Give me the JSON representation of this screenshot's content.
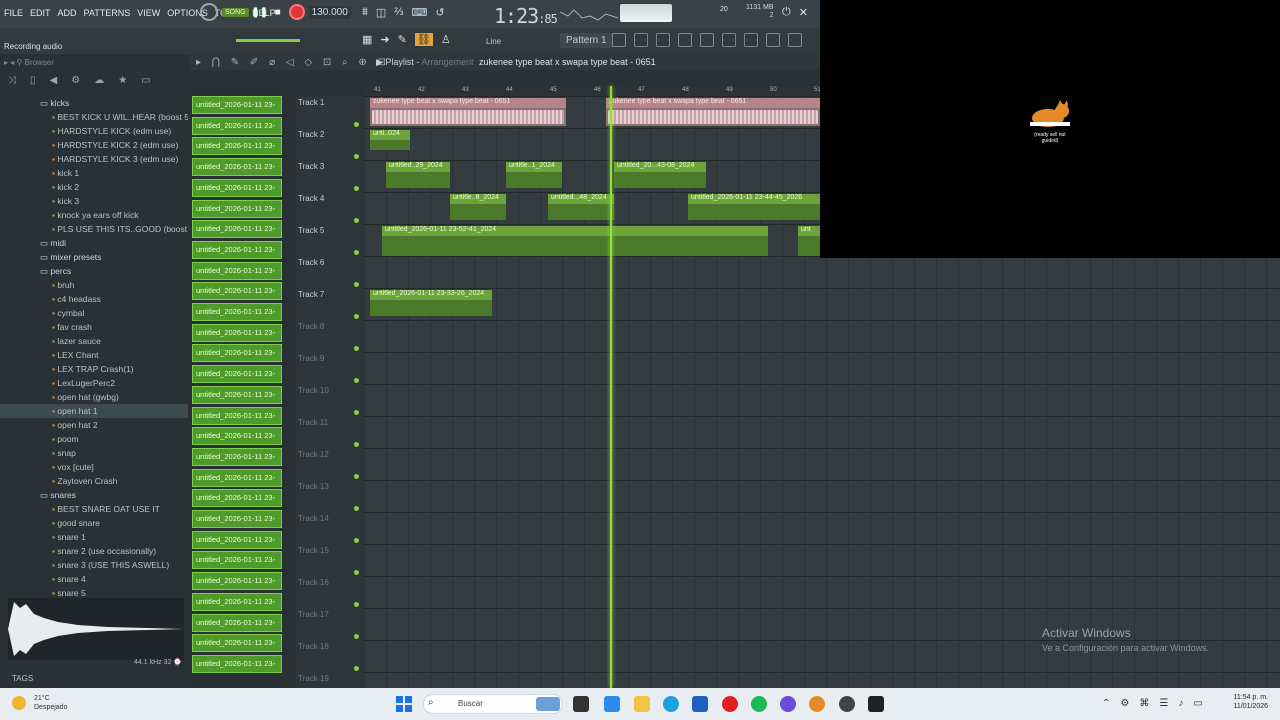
{
  "menu": [
    "FILE",
    "EDIT",
    "ADD",
    "PATTERNS",
    "VIEW",
    "OPTIONS",
    "TOOLS",
    "HELP"
  ],
  "transport": {
    "song_mode": "SONG",
    "tempo": "130.000",
    "time": "1:23",
    "time_small": ":85",
    "cpu_line1": "1131 MB",
    "cpu_line2": "2",
    "cpu_line3": "20"
  },
  "recording_label": "Recording audio",
  "toolbar": {
    "snap": "Line",
    "pattern": "Pattern 1"
  },
  "browser": {
    "title": "Browser",
    "tags": "TAGS",
    "wave_info": "44.1 kHz 32 ⌚",
    "items": [
      {
        "label": "kicks",
        "folder": true
      },
      {
        "label": "BEST KICK U WIL..HEAR (boost 5%)"
      },
      {
        "label": "HARDSTYLE KICK (edm use)"
      },
      {
        "label": "HARDSTYLE KICK 2 (edm use)"
      },
      {
        "label": "HARDSTYLE KICK 3 (edm use)"
      },
      {
        "label": "kick 1"
      },
      {
        "label": "kick 2"
      },
      {
        "label": "kick 3"
      },
      {
        "label": "knock ya ears off kick"
      },
      {
        "label": "PLS USE THIS ITS..GOOD (boost 8%)"
      },
      {
        "label": "midi",
        "folder": true
      },
      {
        "label": "mixer presets",
        "folder": true
      },
      {
        "label": "percs",
        "folder": true
      },
      {
        "label": "bruh"
      },
      {
        "label": "c4 headass"
      },
      {
        "label": "cymbal"
      },
      {
        "label": "fav crash"
      },
      {
        "label": "lazer sauce"
      },
      {
        "label": "LEX Chant"
      },
      {
        "label": "LEX TRAP Crash(1)"
      },
      {
        "label": "LexLugerPerc2"
      },
      {
        "label": "open hat (gwbg)"
      },
      {
        "label": "open hat 1",
        "selected": true
      },
      {
        "label": "open hat 2"
      },
      {
        "label": "poom"
      },
      {
        "label": "snap"
      },
      {
        "label": "vox [cute]"
      },
      {
        "label": "Zaytoven Crash"
      },
      {
        "label": "snares",
        "folder": true
      },
      {
        "label": "BEST SNARE OAT USE IT"
      },
      {
        "label": "good snare"
      },
      {
        "label": "snare 1"
      },
      {
        "label": "snare 2 (use occasionally)"
      },
      {
        "label": "snare 3 (USE THIS ASWELL)"
      },
      {
        "label": "snare 4"
      },
      {
        "label": "snare 5"
      }
    ]
  },
  "patterns": "untitled_2026-01-11 23-",
  "playlist": {
    "title": "Playlist",
    "sub": "Arrangement",
    "project": "zukenee type beat x swapa type beat - 0651",
    "tracks": [
      "Track 1",
      "Track 2",
      "Track 3",
      "Track 4",
      "Track 5",
      "Track 6",
      "Track 7",
      "Track 8",
      "Track 9",
      "Track 10",
      "Track 11",
      "Track 12",
      "Track 13",
      "Track 14",
      "Track 15",
      "Track 16",
      "Track 17",
      "Track 18",
      "Track 19"
    ],
    "bars": [
      "41",
      "42",
      "43",
      "44",
      "45",
      "46",
      "47",
      "48",
      "49",
      "50",
      "51"
    ],
    "clips": {
      "audio1": "zukenee type beat x swapa type beat - 0651",
      "audio2": "zukenee type beat x swapa type beat - 0651",
      "t2": "unti..024",
      "t3a": "untitled..29_2024",
      "t3b": "untitle..1_2024",
      "t3c": "untitled_20...43-08_2024",
      "t4a": "untitle..8_2024",
      "t4b": "untitled...48_2024",
      "t4c": "untitled_2026-01-11 23-44-45_2026",
      "t5a": "untitled_2026-01-11 23-52-41_2024",
      "t5b": "unt",
      "t7": "untitled_2026-01-11 23-33-26_2024"
    }
  },
  "windows": {
    "activate": "Activar Windows",
    "activate_sub": "Ve a Configuración para activar Windows.",
    "search": "Buscar",
    "weather_temp": "21°C",
    "weather_desc": "Despejado",
    "clock_time": "11:54 p. m.",
    "clock_date": "11/01/2026",
    "cat_caption": "(ready sell nut guided)"
  },
  "colors": {
    "accent": "#7ed04a",
    "pattern_fill": "#4e9a2a",
    "audio_clip": "#b5858a",
    "record": "#e0363a"
  }
}
